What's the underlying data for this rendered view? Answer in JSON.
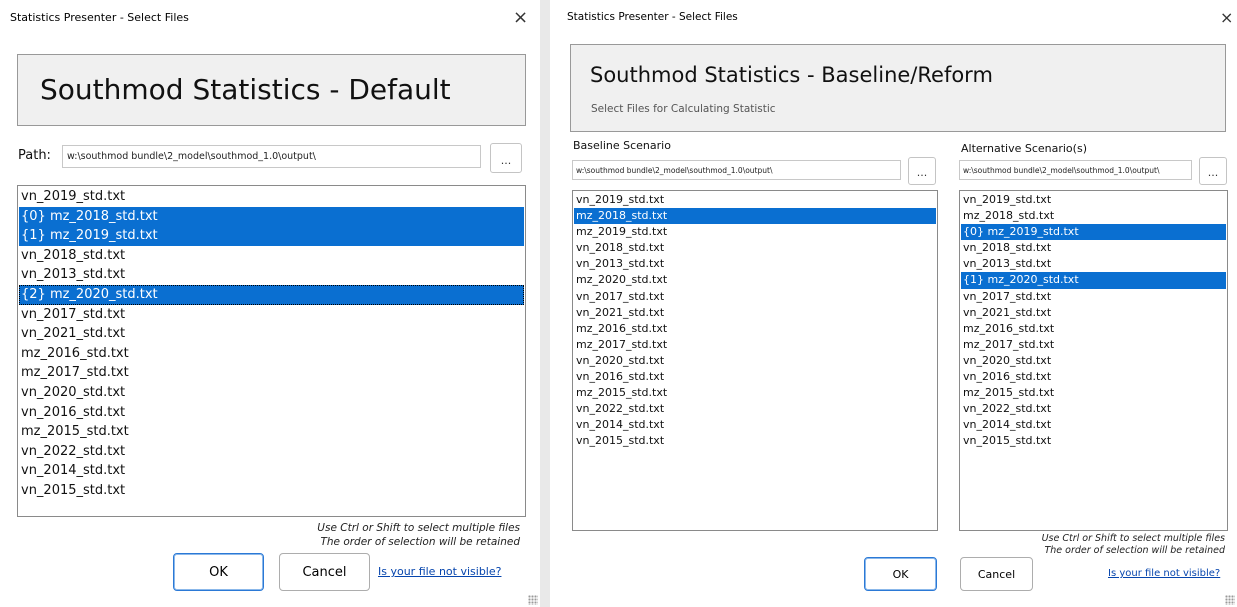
{
  "left": {
    "title": "Statistics Presenter - Select Files",
    "close_glyph": "×",
    "heading": "Southmod Statistics - Default",
    "path_label": "Path:",
    "path_value": "w:\\southmod bundle\\2_model\\southmod_1.0\\output\\",
    "browse_label": "...",
    "files": [
      {
        "text": "vn_2019_std.txt",
        "selected": false
      },
      {
        "text": "{0} mz_2018_std.txt",
        "selected": true
      },
      {
        "text": "{1} mz_2019_std.txt",
        "selected": true
      },
      {
        "text": "vn_2018_std.txt",
        "selected": false
      },
      {
        "text": "vn_2013_std.txt",
        "selected": false
      },
      {
        "text": "{2} mz_2020_std.txt",
        "selected": true,
        "focus": true
      },
      {
        "text": "vn_2017_std.txt",
        "selected": false
      },
      {
        "text": "vn_2021_std.txt",
        "selected": false
      },
      {
        "text": "mz_2016_std.txt",
        "selected": false
      },
      {
        "text": "mz_2017_std.txt",
        "selected": false
      },
      {
        "text": "vn_2020_std.txt",
        "selected": false
      },
      {
        "text": "vn_2016_std.txt",
        "selected": false
      },
      {
        "text": "mz_2015_std.txt",
        "selected": false
      },
      {
        "text": "vn_2022_std.txt",
        "selected": false
      },
      {
        "text": "vn_2014_std.txt",
        "selected": false
      },
      {
        "text": "vn_2015_std.txt",
        "selected": false
      }
    ],
    "hint_line1": "Use Ctrl or Shift to select multiple files",
    "hint_line2": "The order of selection will be retained",
    "ok_label": "OK",
    "cancel_label": "Cancel",
    "link_label": "Is your file not visible?"
  },
  "right": {
    "title": "Statistics Presenter - Select Files",
    "close_glyph": "×",
    "heading": "Southmod Statistics - Baseline/Reform",
    "subheading": "Select Files for Calculating Statistic",
    "baseline_label": "Baseline Scenario",
    "alternative_label": "Alternative Scenario(s)",
    "baseline_path": "w:\\southmod bundle\\2_model\\southmod_1.0\\output\\",
    "alternative_path": "w:\\southmod bundle\\2_model\\southmod_1.0\\output\\",
    "browse_label": "...",
    "baseline_files": [
      {
        "text": "vn_2019_std.txt",
        "selected": false
      },
      {
        "text": "mz_2018_std.txt",
        "selected": true
      },
      {
        "text": "mz_2019_std.txt",
        "selected": false
      },
      {
        "text": "vn_2018_std.txt",
        "selected": false
      },
      {
        "text": "vn_2013_std.txt",
        "selected": false
      },
      {
        "text": "mz_2020_std.txt",
        "selected": false
      },
      {
        "text": "vn_2017_std.txt",
        "selected": false
      },
      {
        "text": "vn_2021_std.txt",
        "selected": false
      },
      {
        "text": "mz_2016_std.txt",
        "selected": false
      },
      {
        "text": "mz_2017_std.txt",
        "selected": false
      },
      {
        "text": "vn_2020_std.txt",
        "selected": false
      },
      {
        "text": "vn_2016_std.txt",
        "selected": false
      },
      {
        "text": "mz_2015_std.txt",
        "selected": false
      },
      {
        "text": "vn_2022_std.txt",
        "selected": false
      },
      {
        "text": "vn_2014_std.txt",
        "selected": false
      },
      {
        "text": "vn_2015_std.txt",
        "selected": false
      }
    ],
    "alternative_files": [
      {
        "text": "vn_2019_std.txt",
        "selected": false
      },
      {
        "text": "mz_2018_std.txt",
        "selected": false
      },
      {
        "text": "{0} mz_2019_std.txt",
        "selected": true
      },
      {
        "text": "vn_2018_std.txt",
        "selected": false
      },
      {
        "text": "vn_2013_std.txt",
        "selected": false
      },
      {
        "text": "{1} mz_2020_std.txt",
        "selected": true
      },
      {
        "text": "vn_2017_std.txt",
        "selected": false
      },
      {
        "text": "vn_2021_std.txt",
        "selected": false
      },
      {
        "text": "mz_2016_std.txt",
        "selected": false
      },
      {
        "text": "mz_2017_std.txt",
        "selected": false
      },
      {
        "text": "vn_2020_std.txt",
        "selected": false
      },
      {
        "text": "vn_2016_std.txt",
        "selected": false
      },
      {
        "text": "mz_2015_std.txt",
        "selected": false
      },
      {
        "text": "vn_2022_std.txt",
        "selected": false
      },
      {
        "text": "vn_2014_std.txt",
        "selected": false
      },
      {
        "text": "vn_2015_std.txt",
        "selected": false
      }
    ],
    "hint_line1": "Use Ctrl or Shift to select multiple files",
    "hint_line2": "The order of selection will be retained",
    "ok_label": "OK",
    "cancel_label": "Cancel",
    "link_label": "Is your file not visible?"
  }
}
